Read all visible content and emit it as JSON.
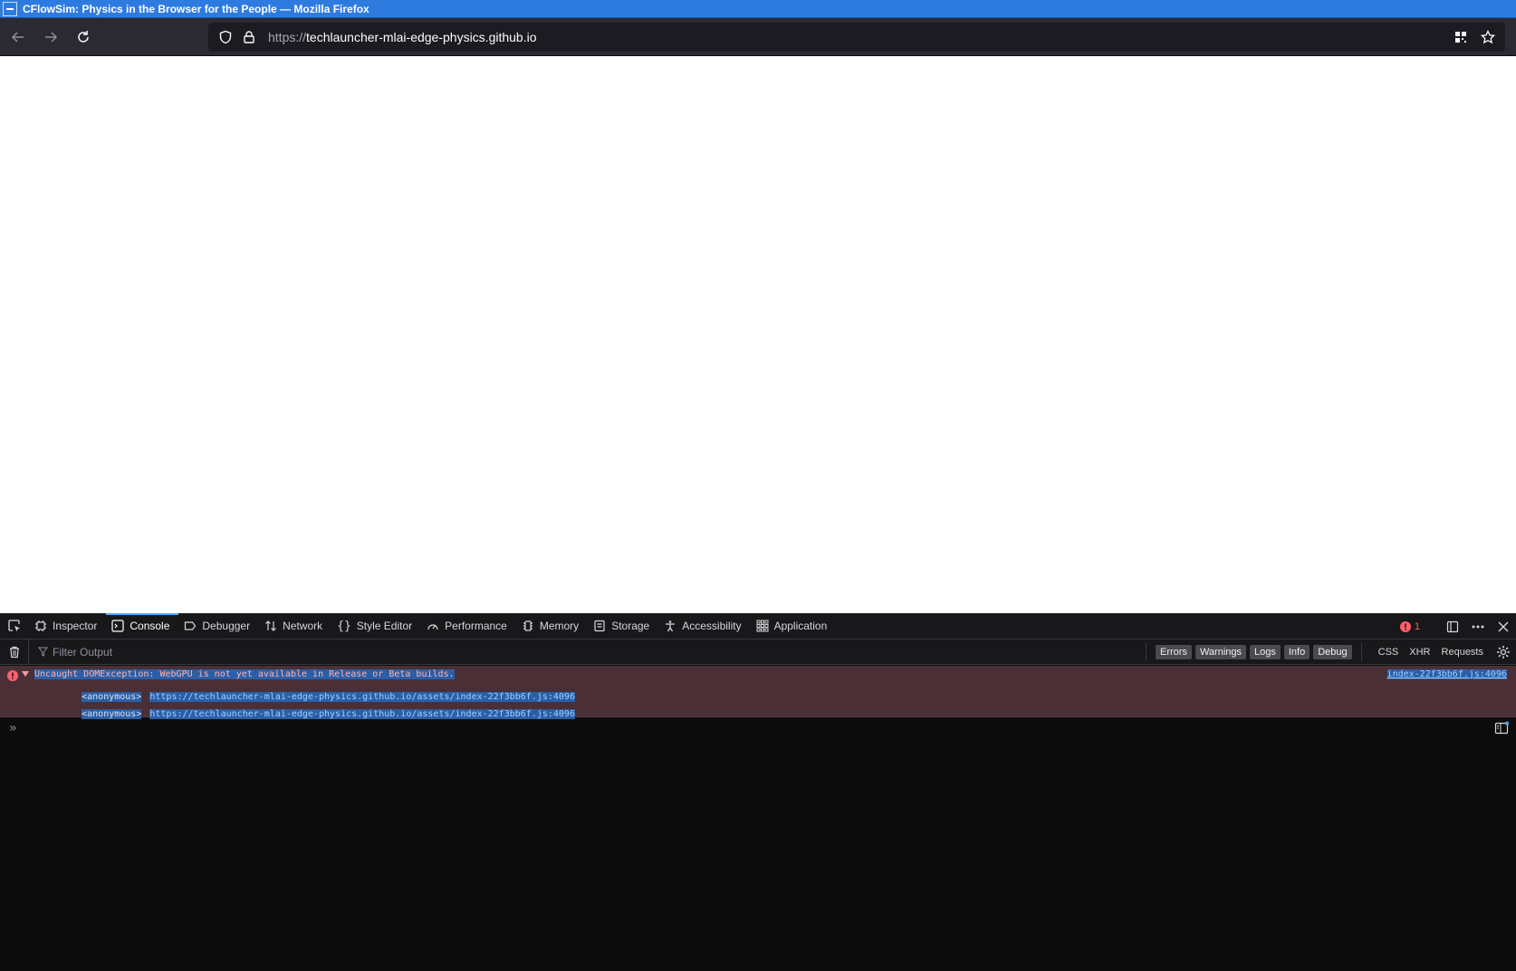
{
  "window": {
    "title": "CFlowSim: Physics in the Browser for the People — Mozilla Firefox"
  },
  "navbar": {
    "url_protocol": "https://",
    "url_host": "techlauncher-mlai-edge-physics.github.io"
  },
  "devtools": {
    "tabs": [
      {
        "label": "Inspector",
        "icon": "inspector-icon"
      },
      {
        "label": "Console",
        "icon": "console-icon"
      },
      {
        "label": "Debugger",
        "icon": "debugger-icon"
      },
      {
        "label": "Network",
        "icon": "network-icon"
      },
      {
        "label": "Style Editor",
        "icon": "style-editor-icon"
      },
      {
        "label": "Performance",
        "icon": "performance-icon"
      },
      {
        "label": "Memory",
        "icon": "memory-icon"
      },
      {
        "label": "Storage",
        "icon": "storage-icon"
      },
      {
        "label": "Accessibility",
        "icon": "accessibility-icon"
      },
      {
        "label": "Application",
        "icon": "application-icon"
      }
    ],
    "active_tab": "Console",
    "error_count": "1",
    "filter_placeholder": "Filter Output",
    "filter_chips": [
      "Errors",
      "Warnings",
      "Logs",
      "Info",
      "Debug"
    ],
    "filter_plain": [
      "CSS",
      "XHR",
      "Requests"
    ],
    "console": {
      "message": "Uncaught DOMException: WebGPU is not yet available in Release or Beta builds.",
      "source": "index-22f3bb6f.js:4096",
      "frames": [
        {
          "fn": "<anonymous>",
          "loc": "https://techlauncher-mlai-edge-physics.github.io/assets/index-22f3bb6f.js:4096"
        },
        {
          "fn": "<anonymous>",
          "loc": "https://techlauncher-mlai-edge-physics.github.io/assets/index-22f3bb6f.js:4096"
        }
      ],
      "prompt": "»"
    }
  },
  "colors": {
    "titlebar": "#2e7be0",
    "toolbar": "#2b2a33",
    "error_bg": "#4b2f36",
    "accent": "#4aa8ff"
  }
}
